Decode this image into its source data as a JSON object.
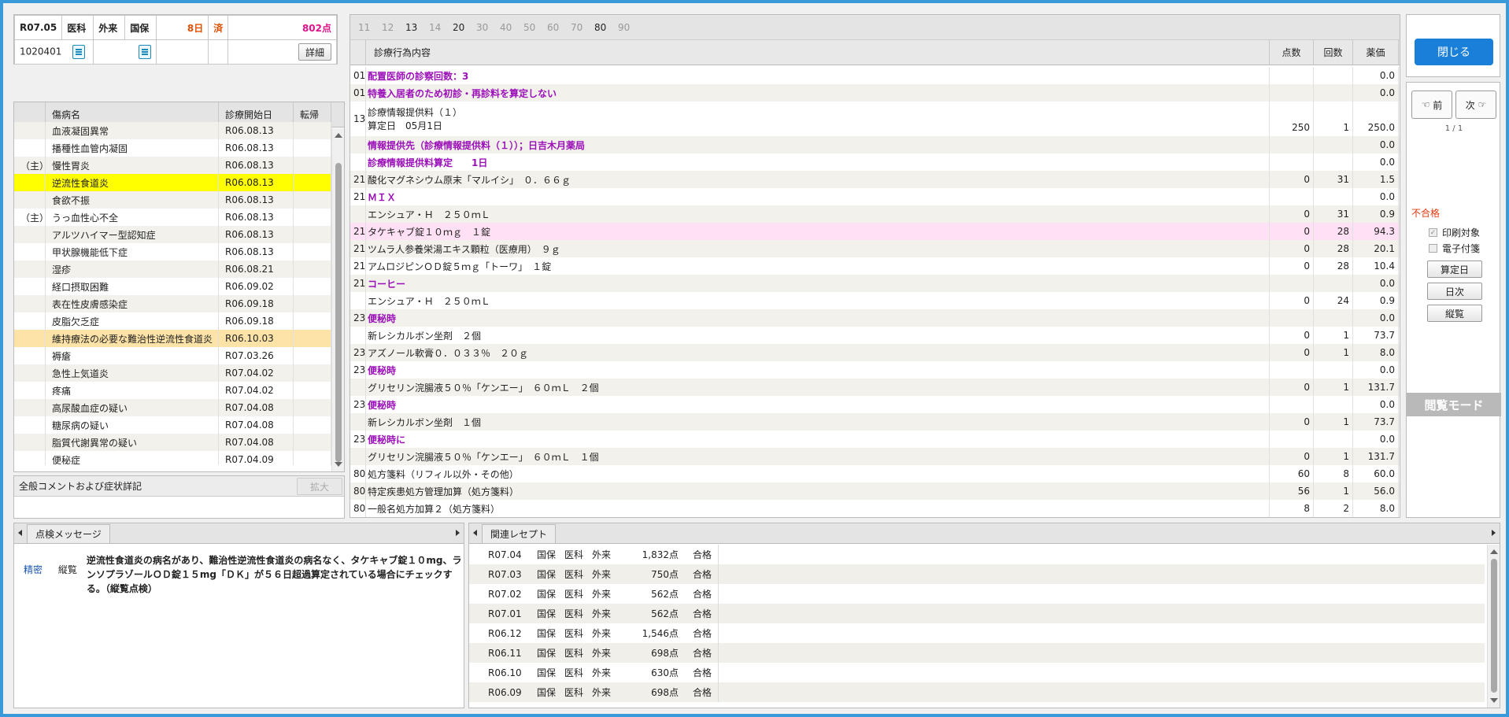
{
  "header": {
    "month": "R07.05",
    "dept": "医科",
    "visit_type": "外来",
    "insurance": "国保",
    "days": "8日",
    "status": "済",
    "points": "802点",
    "patient_id": "1020401",
    "detail_label": "詳細"
  },
  "disease": {
    "col_name": "傷病名",
    "col_start": "診療開始日",
    "col_outcome": "転帰",
    "rows": [
      {
        "mark": "",
        "name": "血液凝固異常",
        "date": "R06.08.13",
        "hl": ""
      },
      {
        "mark": "",
        "name": "播種性血管内凝固",
        "date": "R06.08.13",
        "hl": ""
      },
      {
        "mark": "（主）",
        "name": "慢性胃炎",
        "date": "R06.08.13",
        "hl": ""
      },
      {
        "mark": "",
        "name": "逆流性食道炎",
        "date": "R06.08.13",
        "hl": "yellow"
      },
      {
        "mark": "",
        "name": "食欲不振",
        "date": "R06.08.13",
        "hl": ""
      },
      {
        "mark": "（主）",
        "name": "うっ血性心不全",
        "date": "R06.08.13",
        "hl": ""
      },
      {
        "mark": "",
        "name": "アルツハイマー型認知症",
        "date": "R06.08.13",
        "hl": ""
      },
      {
        "mark": "",
        "name": "甲状腺機能低下症",
        "date": "R06.08.13",
        "hl": ""
      },
      {
        "mark": "",
        "name": "湿疹",
        "date": "R06.08.21",
        "hl": ""
      },
      {
        "mark": "",
        "name": "経口摂取困難",
        "date": "R06.09.02",
        "hl": ""
      },
      {
        "mark": "",
        "name": "表在性皮膚感染症",
        "date": "R06.09.18",
        "hl": ""
      },
      {
        "mark": "",
        "name": "皮脂欠乏症",
        "date": "R06.09.18",
        "hl": ""
      },
      {
        "mark": "",
        "name": "維持療法の必要な難治性逆流性食道炎",
        "date": "R06.10.03",
        "hl": "orange"
      },
      {
        "mark": "",
        "name": "褥瘡",
        "date": "R07.03.26",
        "hl": ""
      },
      {
        "mark": "",
        "name": "急性上気道炎",
        "date": "R07.04.02",
        "hl": ""
      },
      {
        "mark": "",
        "name": "疼痛",
        "date": "R07.04.02",
        "hl": ""
      },
      {
        "mark": "",
        "name": "高尿酸血症の疑い",
        "date": "R07.04.08",
        "hl": ""
      },
      {
        "mark": "",
        "name": "糖尿病の疑い",
        "date": "R07.04.08",
        "hl": ""
      },
      {
        "mark": "",
        "name": "脂質代謝異常の疑い",
        "date": "R07.04.08",
        "hl": ""
      },
      {
        "mark": "",
        "name": "便秘症",
        "date": "R07.04.09",
        "hl": ""
      }
    ]
  },
  "comment": {
    "title": "全般コメントおよび症状詳記",
    "expand_label": "拡大"
  },
  "tabs": [
    {
      "label": "11",
      "active": false
    },
    {
      "label": "12",
      "active": false
    },
    {
      "label": "13",
      "active": true
    },
    {
      "label": "14",
      "active": false
    },
    {
      "label": "20",
      "active": true
    },
    {
      "label": "30",
      "active": false
    },
    {
      "label": "40",
      "active": false
    },
    {
      "label": "50",
      "active": false
    },
    {
      "label": "60",
      "active": false
    },
    {
      "label": "70",
      "active": false
    },
    {
      "label": "80",
      "active": true
    },
    {
      "label": "90",
      "active": false
    }
  ],
  "treatment": {
    "col_content": "診療行為内容",
    "col_points": "点数",
    "col_count": "回数",
    "col_price": "薬価",
    "rows": [
      {
        "code": "01",
        "lines": [
          "配置医師の診察回数：3"
        ],
        "style": "purple",
        "pts": "",
        "cnt": "",
        "price": "0.0"
      },
      {
        "code": "01",
        "lines": [
          "特養入居者のため初診・再診料を算定しない"
        ],
        "style": "purple",
        "pts": "",
        "cnt": "",
        "price": "0.0"
      },
      {
        "code": "13",
        "lines": [
          "診療情報提供料（１）",
          "算定日　05月1日"
        ],
        "style": "",
        "pts": "250",
        "cnt": "1",
        "price": "250.0"
      },
      {
        "code": "",
        "lines": [
          "情報提供先（診療情報提供料（１））；日吉木月薬局"
        ],
        "style": "purple",
        "pts": "",
        "cnt": "",
        "price": "0.0"
      },
      {
        "code": "",
        "lines": [
          "診療情報提供料算定　　1日"
        ],
        "style": "purple",
        "pts": "",
        "cnt": "",
        "price": "0.0"
      },
      {
        "code": "21",
        "lines": [
          "酸化マグネシウム原末「マルイシ」　０．６６ｇ"
        ],
        "style": "",
        "pts": "0",
        "cnt": "31",
        "price": "1.5"
      },
      {
        "code": "21",
        "lines": [
          "ＭＩＸ"
        ],
        "style": "purple",
        "pts": "",
        "cnt": "",
        "price": "0.0"
      },
      {
        "code": "",
        "lines": [
          "エンシュア・Ｈ　２５０ｍＬ"
        ],
        "style": "",
        "pts": "0",
        "cnt": "31",
        "price": "0.9"
      },
      {
        "code": "21",
        "lines": [
          "タケキャブ錠１０ｍｇ　１錠"
        ],
        "style": "pink",
        "pts": "0",
        "cnt": "28",
        "price": "94.3"
      },
      {
        "code": "21",
        "lines": [
          "ツムラ人参養栄湯エキス顆粒（医療用）　９ｇ"
        ],
        "style": "",
        "pts": "0",
        "cnt": "28",
        "price": "20.1"
      },
      {
        "code": "21",
        "lines": [
          "アムロジピンＯＤ錠５ｍｇ「トーワ」　１錠"
        ],
        "style": "",
        "pts": "0",
        "cnt": "28",
        "price": "10.4"
      },
      {
        "code": "21",
        "lines": [
          "コーヒー"
        ],
        "style": "purple",
        "pts": "",
        "cnt": "",
        "price": "0.0"
      },
      {
        "code": "",
        "lines": [
          "エンシュア・Ｈ　２５０ｍＬ"
        ],
        "style": "",
        "pts": "0",
        "cnt": "24",
        "price": "0.9"
      },
      {
        "code": "23",
        "lines": [
          "便秘時"
        ],
        "style": "purple",
        "pts": "",
        "cnt": "",
        "price": "0.0"
      },
      {
        "code": "",
        "lines": [
          "新レシカルボン坐剤　２個"
        ],
        "style": "",
        "pts": "0",
        "cnt": "1",
        "price": "73.7"
      },
      {
        "code": "23",
        "lines": [
          "アズノール軟膏０．０３３％　２０ｇ"
        ],
        "style": "",
        "pts": "0",
        "cnt": "1",
        "price": "8.0"
      },
      {
        "code": "23",
        "lines": [
          "便秘時"
        ],
        "style": "purple",
        "pts": "",
        "cnt": "",
        "price": "0.0"
      },
      {
        "code": "",
        "lines": [
          "グリセリン浣腸液５０％「ケンエー」　６０ｍＬ　２個"
        ],
        "style": "",
        "pts": "0",
        "cnt": "1",
        "price": "131.7"
      },
      {
        "code": "23",
        "lines": [
          "便秘時"
        ],
        "style": "purple",
        "pts": "",
        "cnt": "",
        "price": "0.0"
      },
      {
        "code": "",
        "lines": [
          "新レシカルボン坐剤　１個"
        ],
        "style": "",
        "pts": "0",
        "cnt": "1",
        "price": "73.7"
      },
      {
        "code": "23",
        "lines": [
          "便秘時に"
        ],
        "style": "purple",
        "pts": "",
        "cnt": "",
        "price": "0.0"
      },
      {
        "code": "",
        "lines": [
          "グリセリン浣腸液５０％「ケンエー」　６０ｍＬ　１個"
        ],
        "style": "",
        "pts": "0",
        "cnt": "1",
        "price": "131.7"
      },
      {
        "code": "80",
        "lines": [
          "処方箋料（リフィル以外・その他）"
        ],
        "style": "",
        "pts": "60",
        "cnt": "8",
        "price": "60.0"
      },
      {
        "code": "80",
        "lines": [
          "特定疾患処方管理加算（処方箋料）"
        ],
        "style": "",
        "pts": "56",
        "cnt": "1",
        "price": "56.0"
      },
      {
        "code": "80",
        "lines": [
          "一般名処方加算２（処方箋料）"
        ],
        "style": "",
        "pts": "8",
        "cnt": "2",
        "price": "8.0"
      }
    ]
  },
  "right_panel": {
    "close_label": "閉じる",
    "prev_label": "前",
    "next_label": "次",
    "page_indicator": "1 / 1",
    "fail_label": "不合格",
    "print_target_label": "印刷対象",
    "e_attach_label": "電子付箋",
    "calc_day_label": "算定日",
    "daily_label": "日次",
    "vertical_label": "縦覧",
    "mode_label": "閲覧モード"
  },
  "check_msg": {
    "tab_label": "点検メッセージ",
    "level": "精密",
    "kind": "縦覧",
    "text": "逆流性食道炎の病名があり、難治性逆流性食道炎の病名なく、タケキャブ錠１０mg、ランソプラゾールＯＤ錠１５mg「ＤＫ」が５６日超過算定されている場合にチェックする。（縦覧点検）"
  },
  "related": {
    "tab_label": "関連レセプト",
    "rows": [
      {
        "month": "R07.04",
        "ins": "国保",
        "dept": "医科",
        "type": "外来",
        "pts": "1,832点",
        "res": "合格"
      },
      {
        "month": "R07.03",
        "ins": "国保",
        "dept": "医科",
        "type": "外来",
        "pts": "750点",
        "res": "合格"
      },
      {
        "month": "R07.02",
        "ins": "国保",
        "dept": "医科",
        "type": "外来",
        "pts": "562点",
        "res": "合格"
      },
      {
        "month": "R07.01",
        "ins": "国保",
        "dept": "医科",
        "type": "外来",
        "pts": "562点",
        "res": "合格"
      },
      {
        "month": "R06.12",
        "ins": "国保",
        "dept": "医科",
        "type": "外来",
        "pts": "1,546点",
        "res": "合格"
      },
      {
        "month": "R06.11",
        "ins": "国保",
        "dept": "医科",
        "type": "外来",
        "pts": "698点",
        "res": "合格"
      },
      {
        "month": "R06.10",
        "ins": "国保",
        "dept": "医科",
        "type": "外来",
        "pts": "630点",
        "res": "合格"
      },
      {
        "month": "R06.09",
        "ins": "国保",
        "dept": "医科",
        "type": "外来",
        "pts": "698点",
        "res": "合格"
      }
    ]
  }
}
